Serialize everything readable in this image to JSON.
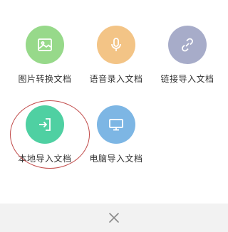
{
  "options": [
    {
      "label": "图片转换文档",
      "icon": "image-icon",
      "color": "#97d98a"
    },
    {
      "label": "语音录入文档",
      "icon": "microphone-icon",
      "color": "#f3c486"
    },
    {
      "label": "链接导入文档",
      "icon": "link-icon",
      "color": "#a7acc9"
    },
    {
      "label": "本地导入文档",
      "icon": "import-file-icon",
      "color": "#4fd0a2",
      "highlighted": true
    },
    {
      "label": "电脑导入文档",
      "icon": "computer-icon",
      "color": "#7db6e4"
    }
  ],
  "footer": {
    "close_icon": "close-icon"
  },
  "annotation_color": "#c14a49"
}
